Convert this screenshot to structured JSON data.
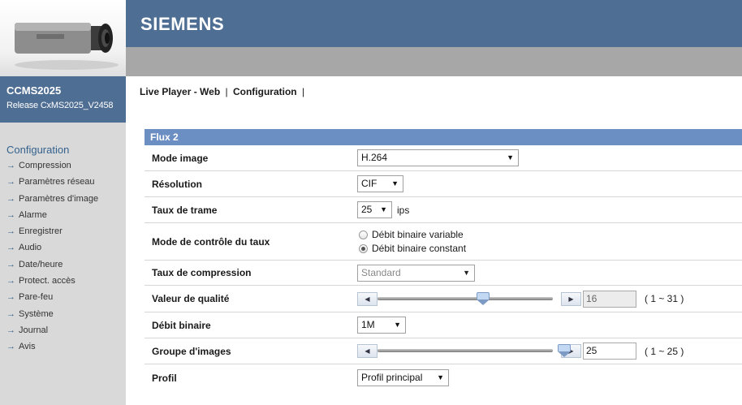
{
  "brand": {
    "name": "SIEMENS"
  },
  "device": {
    "model": "CCMS2025",
    "release": "Release CxMS2025_V2458"
  },
  "menu": {
    "items": [
      "Live Player - Web",
      "Configuration"
    ],
    "separator": "|"
  },
  "nav": {
    "title": "Configuration",
    "items": [
      "Compression",
      "Paramètres réseau",
      "Paramètres d'image",
      "Alarme",
      "Enregistrer",
      "Audio",
      "Date/heure",
      "Protect. accès",
      "Pare-feu",
      "Système",
      "Journal",
      "Avis"
    ]
  },
  "panel": {
    "title": "Flux 2",
    "mode_image": {
      "label": "Mode image",
      "value": "H.264"
    },
    "resolution": {
      "label": "Résolution",
      "value": "CIF"
    },
    "frame_rate": {
      "label": "Taux de trame",
      "value": "25",
      "unit": "ips"
    },
    "rate_control": {
      "label": "Mode de contrôle du taux",
      "options": [
        "Débit binaire variable",
        "Débit binaire constant"
      ],
      "selected": "Débit binaire constant"
    },
    "compression_rate": {
      "label": "Taux de compression",
      "value": "Standard",
      "disabled": true
    },
    "quality": {
      "label": "Valeur de qualité",
      "value": "16",
      "range": "( 1 ~ 31 )",
      "slider_fraction": 0.5,
      "readonly": true
    },
    "bitrate": {
      "label": "Débit binaire",
      "value": "1M"
    },
    "gop": {
      "label": "Groupe d'images",
      "value": "25",
      "range": "( 1 ~ 25 )",
      "slider_fraction": 1.0
    },
    "profile": {
      "label": "Profil",
      "value": "Profil principal"
    }
  },
  "colors": {
    "header": "#4f6e93",
    "panel_head": "#6b8ec3",
    "sidebar": "#d9d9d9",
    "nav_accent": "#34628e"
  }
}
